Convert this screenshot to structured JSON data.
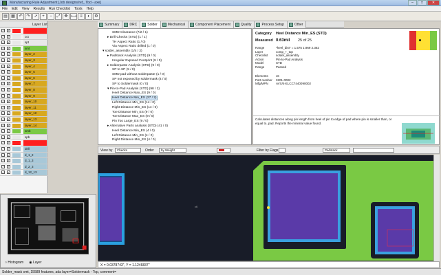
{
  "window": {
    "title": "Manufacturing Rule Adjustment [Job designs/ref_ Tbd - axe]",
    "minimize": "–",
    "maximize": "□",
    "close": "✕"
  },
  "menu": [
    "File",
    "Edit",
    "View",
    "Results",
    "Run Checklist",
    "Tools",
    "Help"
  ],
  "toolbar_icons": [
    "open-icon",
    "save-icon",
    "undo-icon",
    "redo-icon",
    "pointer-icon",
    "zoom-in-icon",
    "zoom-out-icon",
    "zoom-fit-icon",
    "pan-icon",
    "measure-icon",
    "layers-icon",
    "highlight-icon",
    "settings-icon"
  ],
  "layer_list": {
    "header": "Layer List",
    "rows": [
      {
        "name": "",
        "color": "#ff2020"
      },
      {
        "name": "cct",
        "color": "#e8e8e8"
      },
      {
        "name": "spt",
        "color": "#e8e8e8"
      },
      {
        "name": "smt",
        "color": "#7ac944"
      },
      {
        "name": "layer_2",
        "color": "#d8a820"
      },
      {
        "name": "layer_3",
        "color": "#d8a820"
      },
      {
        "name": "layer_4",
        "color": "#d8a820"
      },
      {
        "name": "layer_5",
        "color": "#d8a820"
      },
      {
        "name": "layer_6",
        "color": "#d8a820"
      },
      {
        "name": "layer_7",
        "color": "#d8a820"
      },
      {
        "name": "layer_8",
        "color": "#d8a820"
      },
      {
        "name": "layer_9",
        "color": "#d8a820"
      },
      {
        "name": "layer_10",
        "color": "#d8a820"
      },
      {
        "name": "layer_11",
        "color": "#d8a820"
      },
      {
        "name": "layer_12",
        "color": "#d8a820"
      },
      {
        "name": "layer_13",
        "color": "#d8a820"
      },
      {
        "name": "layer_14",
        "color": "#d8a820"
      },
      {
        "name": "smb",
        "color": "#7ac944"
      },
      {
        "name": "spb",
        "color": "#e8e8e8"
      },
      {
        "name": "",
        "color": "#ff2020"
      },
      {
        "name": "drill",
        "color": "#a8c8d8"
      },
      {
        "name": "d_1_2",
        "color": "#a8c8d8"
      },
      {
        "name": "d_1_3",
        "color": "#a8c8d8"
      },
      {
        "name": "d_2_3",
        "color": "#a8c8d8"
      },
      {
        "name": "d_12_13",
        "color": "#a8c8d8"
      }
    ]
  },
  "preview": {
    "option1": "Histogram",
    "option2": "Layer"
  },
  "tabs": [
    {
      "label": "Summary",
      "active": false
    },
    {
      "label": "DRC",
      "active": false
    },
    {
      "label": "Solder",
      "active": true
    },
    {
      "label": "Mechanical",
      "active": false
    },
    {
      "label": "Component Placement",
      "active": false
    },
    {
      "label": "Quality",
      "active": false
    },
    {
      "label": "Process Setup",
      "active": false
    },
    {
      "label": "Other",
      "active": false
    }
  ],
  "tree": [
    {
      "text": "SMD Clearance (7/2 / 1)",
      "indent": 2
    },
    {
      "text": "▸ Drill Checks (STD) (1 / 1)",
      "indent": 1
    },
    {
      "text": "TH Aspect Ratio (1 / 0)",
      "indent": 2
    },
    {
      "text": "Via Aspect Ratio drilled (1 / 0)",
      "indent": 2
    },
    {
      "text": "▾ solder_assembly (1/4 / 2)",
      "indent": 0
    },
    {
      "text": "▸ Padstack Analysis (STD) (9 / 0)",
      "indent": 1
    },
    {
      "text": "Irregular Exposed Footprint (9 / 0)",
      "indent": 2
    },
    {
      "text": "▸ Solderpaste Analysis (STD) (9 / 0)",
      "indent": 1
    },
    {
      "text": "SP to SP (5 / 0)",
      "indent": 2
    },
    {
      "text": "SMD pad without solderpaste (1 / 0)",
      "indent": 2
    },
    {
      "text": "SP not exposed by soldermask (4 / 0)",
      "indent": 2
    },
    {
      "text": "SP to Soldermask (0 / 0)",
      "indent": 2
    },
    {
      "text": "▾ Pin-to-Pad Analysis (STD) (98 / 2)",
      "indent": 1
    },
    {
      "text": "Heel Distance Max_ES (9 / 0)",
      "indent": 2
    },
    {
      "text": "Heel Distance Min_ES (27 / 2)",
      "indent": 2,
      "selected": true
    },
    {
      "text": "Left Distance Min_ES (14 / 0)",
      "indent": 2
    },
    {
      "text": "Right Distance Min_ES (14 / 0)",
      "indent": 2
    },
    {
      "text": "Toe Distance Min_ES (9 / 0)",
      "indent": 2
    },
    {
      "text": "Toe Distance Max_ES (9 / 0)",
      "indent": 2
    },
    {
      "text": "Pin Too Large_ES (9 / 0)",
      "indent": 2
    },
    {
      "text": "▸ Alternative Parts analysis (STD) (41 / 0)",
      "indent": 1
    },
    {
      "text": "Heel Distance Min_ES (4 / 0)",
      "indent": 2
    },
    {
      "text": "Left Distance Min_ES (4 / 0)",
      "indent": 2
    },
    {
      "text": "Right Distance Min_ES (4 / 0)",
      "indent": 2
    }
  ],
  "detail": {
    "category_label": "Category",
    "category_value": "Heel Distance Min_ES (STD)",
    "measured_label": "Measured",
    "measured_value": "0.63mil",
    "measured_count": "25 of 25",
    "props": [
      {
        "k": "Range",
        "v": "*heel_dist* = 1.575 1.969 2.362"
      },
      {
        "k": "Layer",
        "v": "comp_+_top"
      },
      {
        "k": "Checklist",
        "v": "solder_assembly"
      },
      {
        "k": "Action",
        "v": "Pin-to-Pad Analysis"
      },
      {
        "k": "Model",
        "v": "STD"
      },
      {
        "k": "Range",
        "v": "Passed"
      }
    ],
    "props2": [
      {
        "k": "Elements",
        "v": "c6"
      },
      {
        "k": "Part number",
        "v": "3201-0002"
      },
      {
        "k": "Mfg/MPN",
        "v": "AVX/4-ELCC7440090002"
      }
    ],
    "description": "Calculates distances along pin length from heel of pin to edge of pad where pin is smaller than, or equal to, pad. Reports the minimal value found.",
    "swatch_colors": [
      "#e03030",
      "#ffe033",
      "#ffe033",
      "#7ac944"
    ]
  },
  "filterbar": {
    "view_by_label": "View by",
    "view_by_value": "Checks",
    "order_label": "Order",
    "order_value": "by Weight",
    "filter_label": "Filter by Flags",
    "filter_value": "Padstack"
  },
  "canvas": {
    "marker_label": "c6",
    "swap_label": ""
  },
  "coords": "X = 0.0378743\", Y = 1.1246837\"",
  "status": "Solder_mask smt, 15589 features, ada layer=Soldermask - Top, comment="
}
